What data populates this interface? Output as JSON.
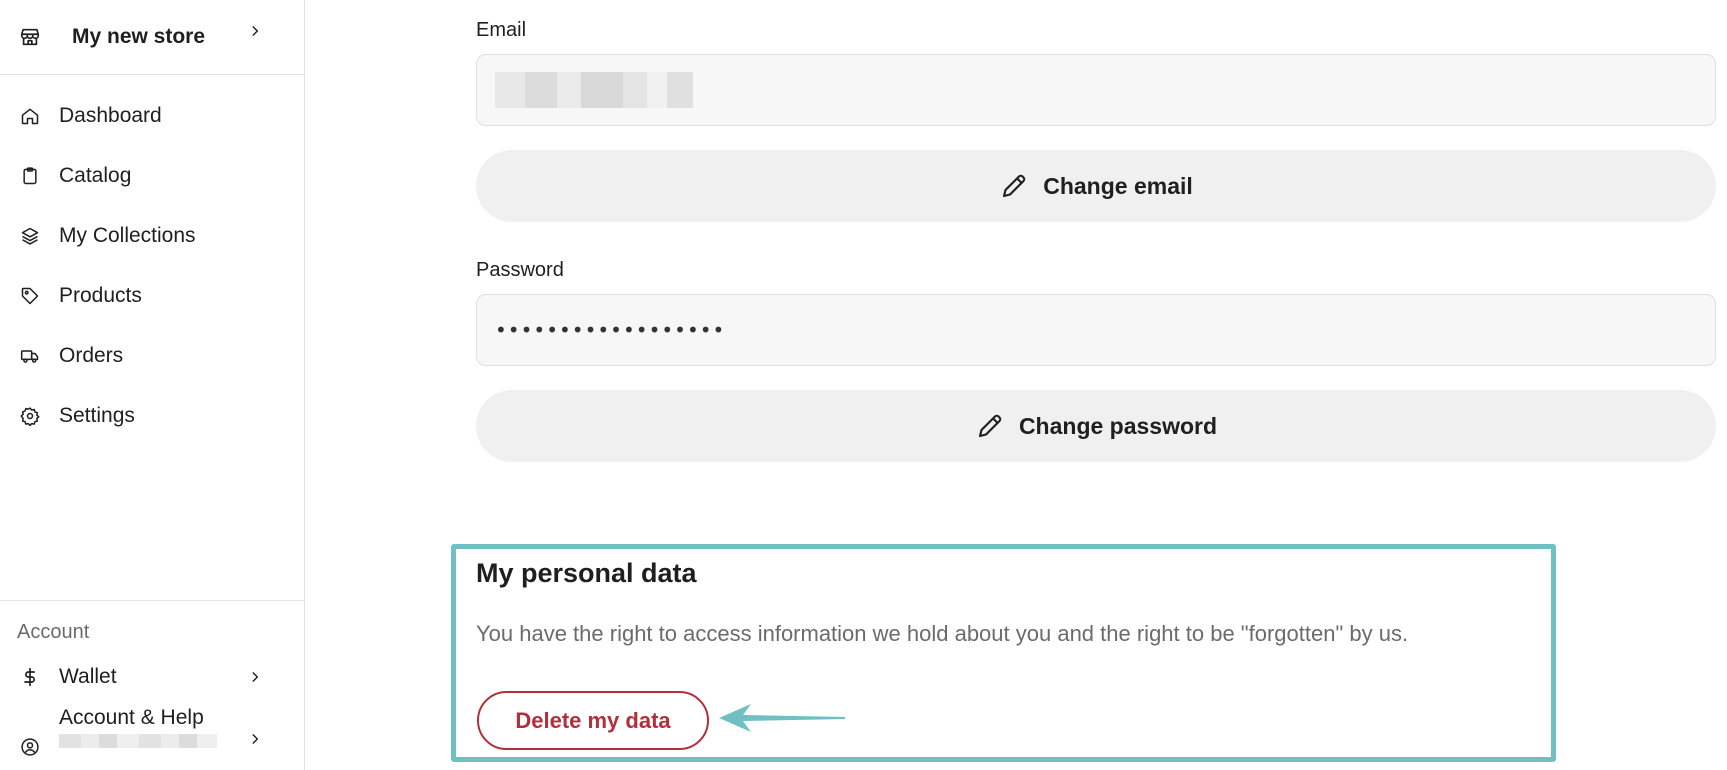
{
  "store": {
    "name": "My new store"
  },
  "nav": {
    "items": [
      {
        "label": "Dashboard",
        "icon": "home-icon"
      },
      {
        "label": "Catalog",
        "icon": "clipboard-icon"
      },
      {
        "label": "My Collections",
        "icon": "layers-icon"
      },
      {
        "label": "Products",
        "icon": "tag-icon"
      },
      {
        "label": "Orders",
        "icon": "truck-icon"
      },
      {
        "label": "Settings",
        "icon": "gear-icon"
      }
    ]
  },
  "account": {
    "title": "Account",
    "wallet": "Wallet",
    "help": "Account & Help"
  },
  "form": {
    "email_label": "Email",
    "change_email": "Change email",
    "password_label": "Password",
    "password_value": "••••••••••••••••••",
    "change_password": "Change password"
  },
  "personal": {
    "title": "My personal data",
    "description": "You have the right to access information we hold about you and the right to be \"forgotten\" by us.",
    "delete_label": "Delete my data"
  },
  "colors": {
    "highlight": "#6ec0c2",
    "danger": "#b0303b",
    "button_bg": "#f0f0f0"
  }
}
